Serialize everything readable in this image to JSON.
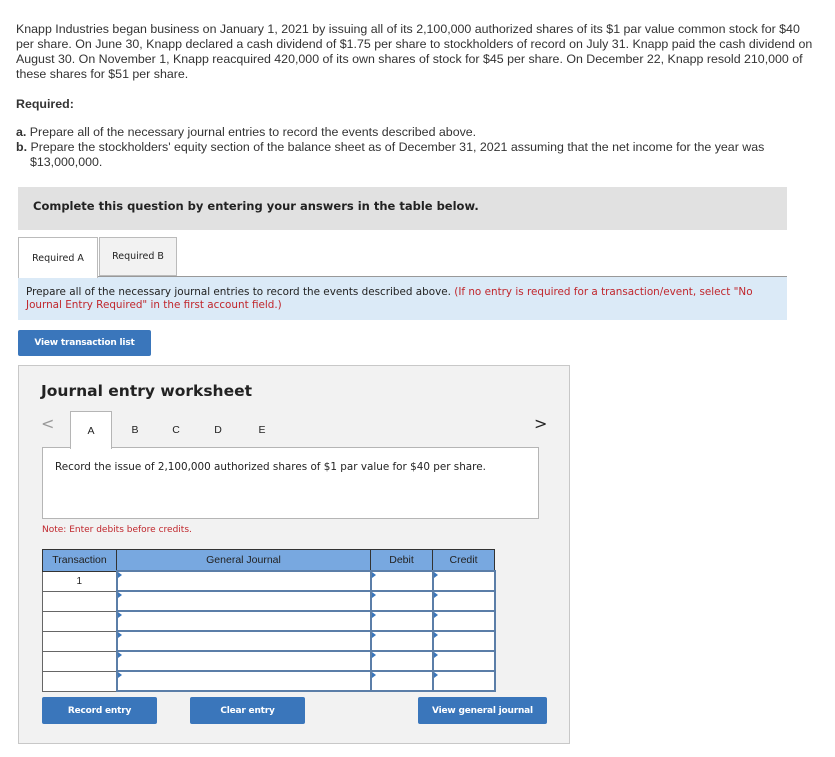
{
  "problem": {
    "text": "Knapp Industries began business on January 1, 2021 by issuing all of its 2,100,000 authorized shares of its $1 par value common stock for $40 per share. On June 30, Knapp declared a cash dividend of $1.75 per share to stockholders of record on July 31. Knapp paid the cash dividend on August 30. On November 1, Knapp reacquired 420,000 of its own shares of stock for $45 per share. On December 22, Knapp resold 210,000 of these shares for $51 per share."
  },
  "required": {
    "title": "Required:",
    "items": [
      {
        "marker": "a.",
        "text": "Prepare all of the necessary journal entries to record the events described above."
      },
      {
        "marker": "b.",
        "text": "Prepare the stockholders' equity section of the balance sheet as of December 31, 2021 assuming that the net income for the year was $13,000,000."
      }
    ]
  },
  "banner": "Complete this question by entering your answers in the table below.",
  "tabs": [
    {
      "label": "Required A",
      "active": true
    },
    {
      "label": "Required B",
      "active": false
    }
  ],
  "instruction": {
    "text": "Prepare all of the necessary journal entries to record the events described above.",
    "hint": "(If no entry is required for a transaction/event, select \"No Journal Entry Required\" in the first account field.)"
  },
  "view_transaction_list": "View transaction list",
  "worksheet": {
    "title": "Journal entry worksheet",
    "prev_icon": "<",
    "next_icon": ">",
    "letters": [
      "A",
      "B",
      "C",
      "D",
      "E"
    ],
    "active_letter": "A",
    "description": "Record the issue of 2,100,000 authorized shares of $1 par value for $40 per share.",
    "note": "Note: Enter debits before credits.",
    "table": {
      "headers": [
        "Transaction",
        "General Journal",
        "Debit",
        "Credit"
      ],
      "rows": [
        {
          "transaction": "1",
          "account": "",
          "debit": "",
          "credit": ""
        },
        {
          "transaction": "",
          "account": "",
          "debit": "",
          "credit": ""
        },
        {
          "transaction": "",
          "account": "",
          "debit": "",
          "credit": ""
        },
        {
          "transaction": "",
          "account": "",
          "debit": "",
          "credit": ""
        },
        {
          "transaction": "",
          "account": "",
          "debit": "",
          "credit": ""
        },
        {
          "transaction": "",
          "account": "",
          "debit": "",
          "credit": ""
        }
      ]
    },
    "buttons": {
      "record": "Record entry",
      "clear": "Clear entry",
      "view_journal": "View general journal"
    }
  },
  "colors": {
    "button_blue": "#3a76bb",
    "header_blue": "#78a8e0",
    "instruction_bg": "#dbeaf7",
    "hint_red": "#c0262c"
  }
}
